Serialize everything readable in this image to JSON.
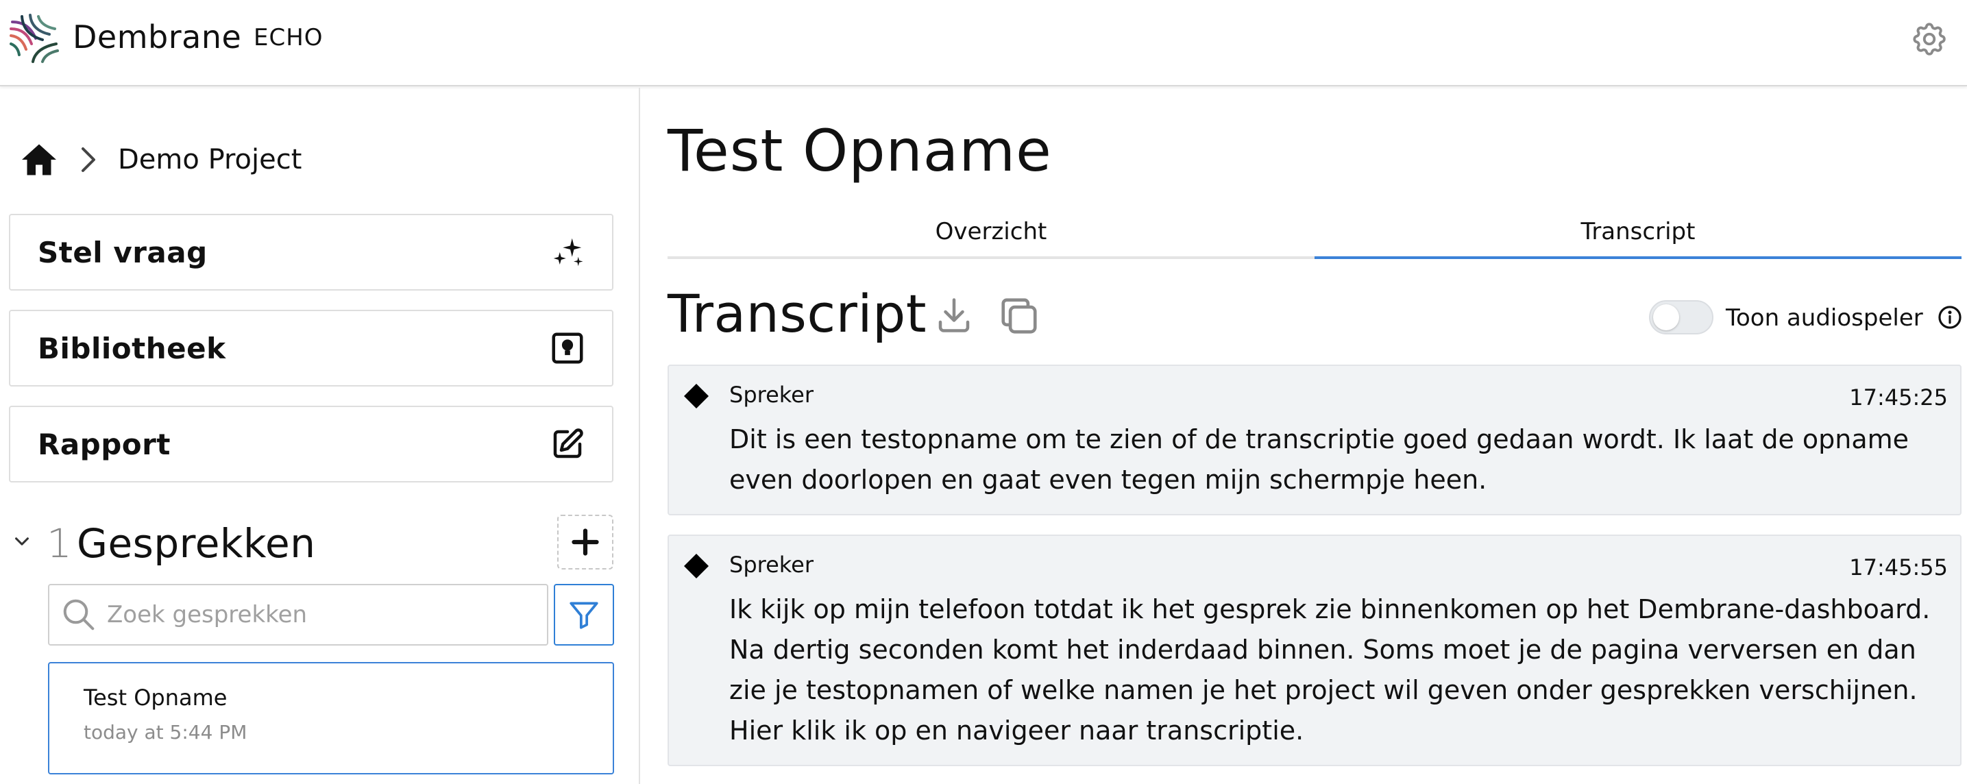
{
  "header": {
    "brand": "Dembrane",
    "app_tag": "ECHO",
    "icons": {
      "logo": "dembrane-logo",
      "settings": "gear-icon"
    }
  },
  "sidebar": {
    "breadcrumb": {
      "home_icon": "home-icon",
      "project": "Demo Project"
    },
    "nav": [
      {
        "label": "Stel vraag",
        "icon": "sparkles-icon"
      },
      {
        "label": "Bibliotheek",
        "icon": "lightbulb-icon"
      },
      {
        "label": "Rapport",
        "icon": "edit-icon"
      }
    ],
    "conversations": {
      "count": "1",
      "title": "Gesprekken",
      "search_placeholder": "Zoek gesprekken",
      "items": [
        {
          "title": "Test Opname",
          "time": "today at 5:44 PM"
        }
      ]
    }
  },
  "main": {
    "title": "Test Opname",
    "tabs": [
      {
        "label": "Overzicht",
        "active": false
      },
      {
        "label": "Transcript",
        "active": true
      }
    ],
    "transcript": {
      "heading": "Transcript",
      "audio_toggle_label": "Toon audiospeler",
      "audio_toggle_on": false,
      "segments": [
        {
          "speaker": "Spreker",
          "time": "17:45:25",
          "text": "Dit is een testopname om te zien of de transcriptie goed gedaan wordt. Ik laat de opname even doorlopen en gaat even tegen mijn schermpje heen."
        },
        {
          "speaker": "Spreker",
          "time": "17:45:55",
          "text": "Ik kijk op mijn telefoon totdat ik het gesprek zie binnenkomen op het Dembrane-dashboard. Na dertig seconden komt het inderdaad binnen. Soms moet je de pagina verversen en dan zie je testopnamen of welke namen je het project wil geven onder gesprekken verschijnen. Hier klik ik op en navigeer naar transcriptie."
        }
      ]
    }
  },
  "colors": {
    "accent": "#3b82d8",
    "segment_bg": "#f1f3f5",
    "muted_text": "#8c8c8c"
  }
}
